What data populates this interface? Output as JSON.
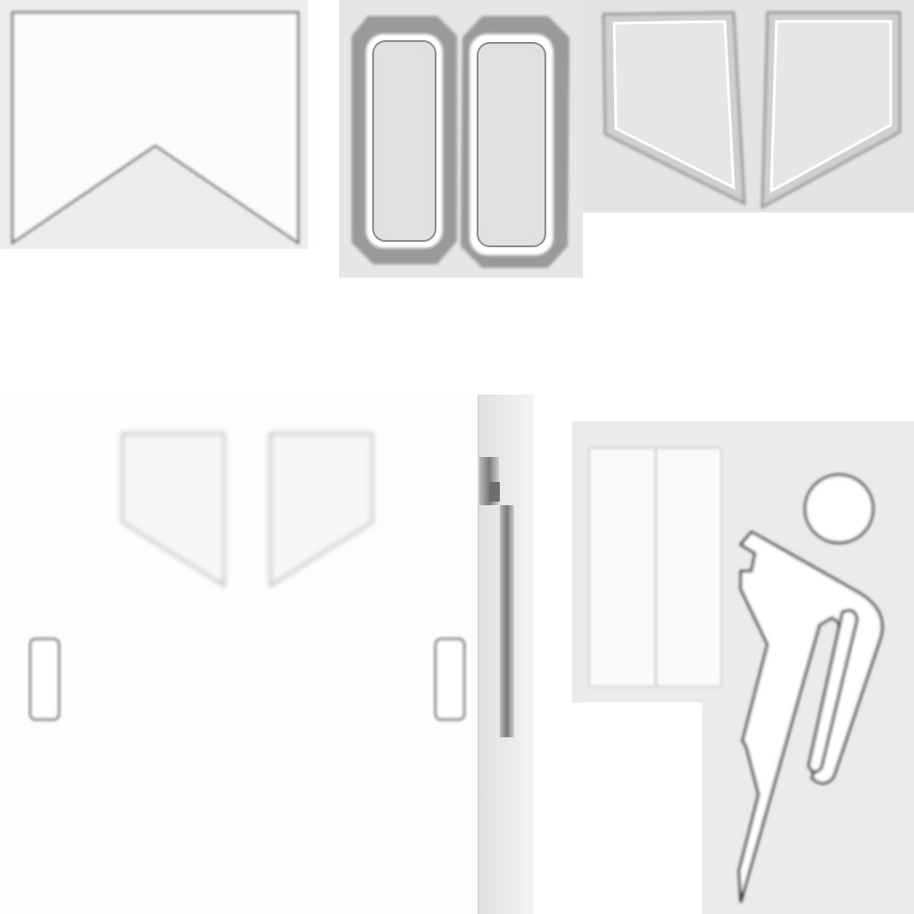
{
  "texture_sheet": {
    "colors": {
      "background": "#ffffff",
      "panel_light": "#f6f6f6",
      "panel_grey": "#e4e4e4",
      "outline_dark": "#555555",
      "frame_dark": "#8e8e8e"
    },
    "islands": [
      "folded-panel-island",
      "rounded-frames-island",
      "window-frames-island",
      "door-panel-island",
      "figure-panel-island"
    ]
  }
}
